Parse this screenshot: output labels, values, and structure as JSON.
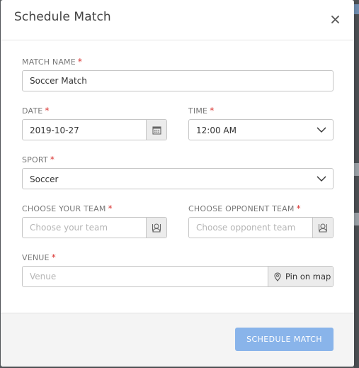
{
  "modal": {
    "title": "Schedule Match",
    "close_icon": "close-icon"
  },
  "form": {
    "match_name": {
      "label": "MATCH NAME",
      "required": "*",
      "value": "Soccer Match"
    },
    "date": {
      "label": "DATE",
      "required": "*",
      "value": "2019-10-27",
      "icon": "calendar-icon"
    },
    "time": {
      "label": "TIME",
      "required": "*",
      "value": "12:00 AM",
      "icon": "chevron-down-icon"
    },
    "sport": {
      "label": "SPORT",
      "required": "*",
      "value": "Soccer",
      "icon": "chevron-down-icon"
    },
    "your_team": {
      "label": "CHOOSE YOUR TEAM",
      "required": "*",
      "placeholder": "Choose your team",
      "icon": "team-icon"
    },
    "opponent_team": {
      "label": "CHOOSE OPPONENT TEAM",
      "required": "*",
      "placeholder": "Choose opponent team",
      "icon": "team-icon"
    },
    "venue": {
      "label": "VENUE",
      "required": "*",
      "placeholder": "Venue",
      "pin_label": "Pin on map",
      "icon": "map-pin-icon"
    }
  },
  "footer": {
    "submit_label": "SCHEDULE MATCH"
  },
  "colors": {
    "required": "#d9322f",
    "primary_button": "#89b4ea",
    "backdrop": "#5b5f63"
  }
}
